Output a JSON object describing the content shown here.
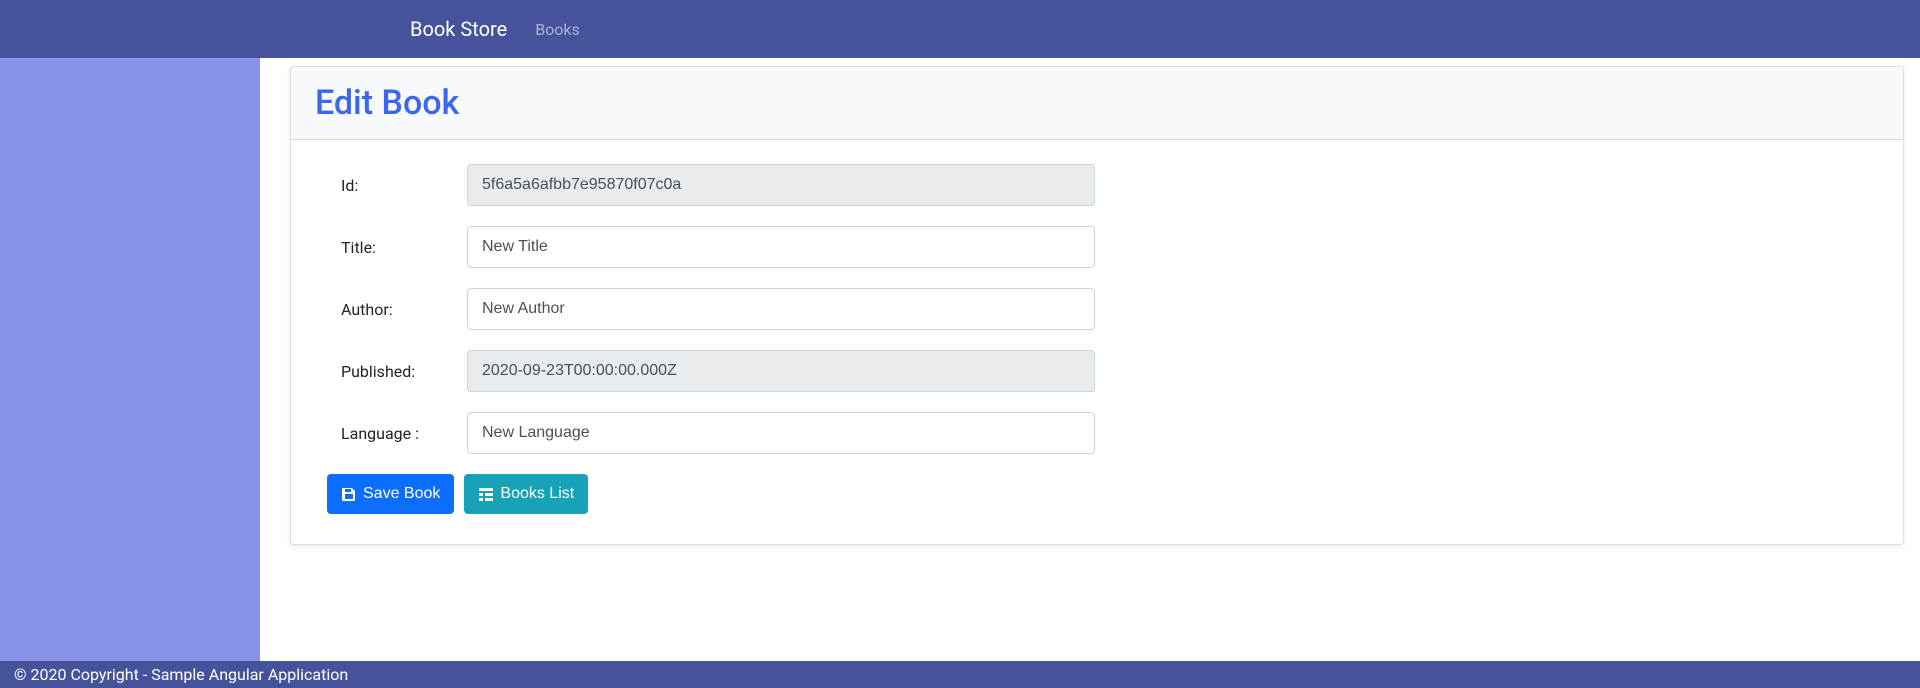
{
  "navbar": {
    "brand": "Book Store",
    "links": [
      {
        "label": "Books"
      }
    ]
  },
  "page": {
    "title": "Edit Book"
  },
  "form": {
    "id": {
      "label": "Id:",
      "value": "5f6a5a6afbb7e95870f07c0a"
    },
    "title": {
      "label": "Title:",
      "value": "New Title"
    },
    "author": {
      "label": "Author:",
      "value": "New Author"
    },
    "published": {
      "label": "Published:",
      "value": "2020-09-23T00:00:00.000Z"
    },
    "language": {
      "label": "Language :",
      "value": "New Language"
    }
  },
  "buttons": {
    "save": {
      "label": "Save Book"
    },
    "list": {
      "label": "Books List"
    }
  },
  "footer": {
    "text": "© 2020 Copyright - Sample Angular Application"
  }
}
